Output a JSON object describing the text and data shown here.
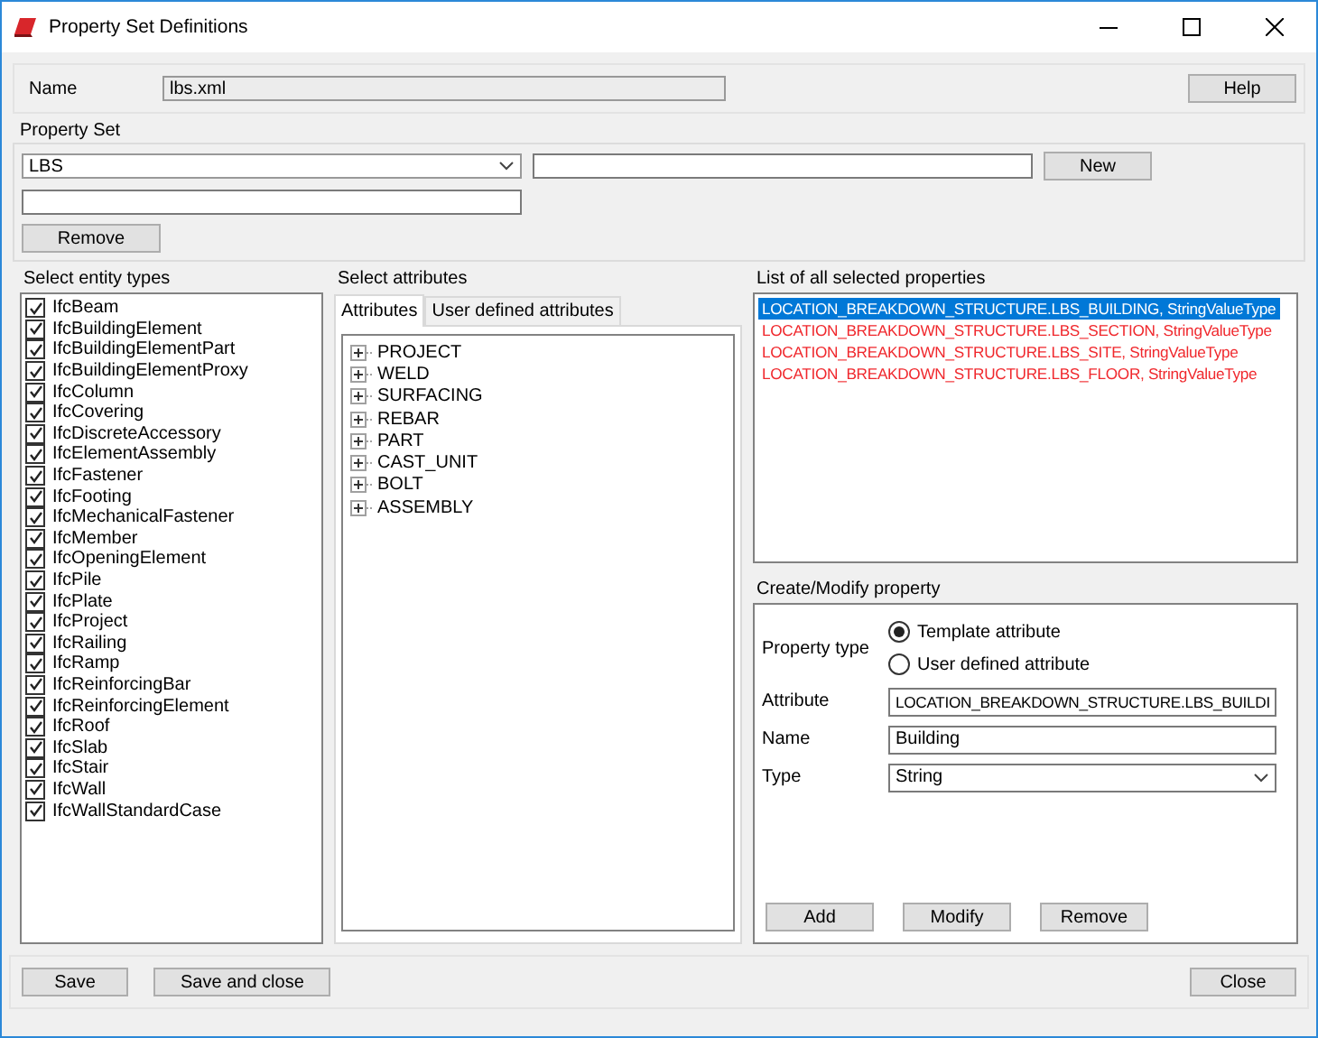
{
  "window": {
    "title": "Property Set Definitions"
  },
  "name": {
    "label": "Name",
    "value": "lbs.xml"
  },
  "help_button": "Help",
  "property_set": {
    "label": "Property Set",
    "value": "LBS",
    "new_button": "New",
    "remove_button": "Remove"
  },
  "entity_types": {
    "label": "Select entity types",
    "items": [
      {
        "name": "IfcBeam",
        "checked": true
      },
      {
        "name": "IfcBuildingElement",
        "checked": true
      },
      {
        "name": "IfcBuildingElementPart",
        "checked": true
      },
      {
        "name": "IfcBuildingElementProxy",
        "checked": true
      },
      {
        "name": "IfcColumn",
        "checked": true
      },
      {
        "name": "IfcCovering",
        "checked": true
      },
      {
        "name": "IfcDiscreteAccessory",
        "checked": true
      },
      {
        "name": "IfcElementAssembly",
        "checked": true
      },
      {
        "name": "IfcFastener",
        "checked": true
      },
      {
        "name": "IfcFooting",
        "checked": true
      },
      {
        "name": "IfcMechanicalFastener",
        "checked": true
      },
      {
        "name": "IfcMember",
        "checked": true
      },
      {
        "name": "IfcOpeningElement",
        "checked": true
      },
      {
        "name": "IfcPile",
        "checked": true
      },
      {
        "name": "IfcPlate",
        "checked": true
      },
      {
        "name": "IfcProject",
        "checked": true
      },
      {
        "name": "IfcRailing",
        "checked": true
      },
      {
        "name": "IfcRamp",
        "checked": true
      },
      {
        "name": "IfcReinforcingBar",
        "checked": true
      },
      {
        "name": "IfcReinforcingElement",
        "checked": true
      },
      {
        "name": "IfcRoof",
        "checked": true
      },
      {
        "name": "IfcSlab",
        "checked": true
      },
      {
        "name": "IfcStair",
        "checked": true
      },
      {
        "name": "IfcWall",
        "checked": true
      },
      {
        "name": "IfcWallStandardCase",
        "checked": true
      }
    ]
  },
  "attributes": {
    "label": "Select attributes",
    "tabs": [
      {
        "label": "Attributes",
        "selected": true
      },
      {
        "label": "User defined attributes",
        "selected": false
      }
    ],
    "tree": [
      {
        "label": "PROJECT",
        "expanded": false
      },
      {
        "label": "WELD",
        "expanded": false
      },
      {
        "label": "SURFACING",
        "expanded": false
      },
      {
        "label": "REBAR",
        "expanded": false
      },
      {
        "label": "PART",
        "expanded": false
      },
      {
        "label": "CAST_UNIT",
        "expanded": false
      },
      {
        "label": "BOLT",
        "expanded": false
      },
      {
        "label": "ASSEMBLY",
        "expanded": false
      }
    ]
  },
  "selected_properties": {
    "label": "List of all selected properties",
    "items": [
      {
        "text": "LOCATION_BREAKDOWN_STRUCTURE.LBS_BUILDING,  StringValueType",
        "selected": true
      },
      {
        "text": "LOCATION_BREAKDOWN_STRUCTURE.LBS_SECTION,  StringValueType",
        "selected": false
      },
      {
        "text": "LOCATION_BREAKDOWN_STRUCTURE.LBS_SITE,  StringValueType",
        "selected": false
      },
      {
        "text": "LOCATION_BREAKDOWN_STRUCTURE.LBS_FLOOR,  StringValueType",
        "selected": false
      }
    ]
  },
  "create_modify": {
    "label": "Create/Modify property",
    "property_type": {
      "label": "Property type",
      "options": [
        {
          "label": "Template attribute",
          "selected": true
        },
        {
          "label": "User defined attribute",
          "selected": false
        }
      ]
    },
    "attribute": {
      "label": "Attribute",
      "value": "LOCATION_BREAKDOWN_STRUCTURE.LBS_BUILDI"
    },
    "name": {
      "label": "Name",
      "value": "Building"
    },
    "type": {
      "label": "Type",
      "value": "String"
    },
    "buttons": [
      "Add",
      "Modify",
      "Remove"
    ]
  },
  "footer_buttons": [
    {
      "label": "Save",
      "kind": "left"
    },
    {
      "label": "Save and close",
      "kind": "left"
    },
    {
      "label": "Close",
      "kind": "right"
    }
  ]
}
